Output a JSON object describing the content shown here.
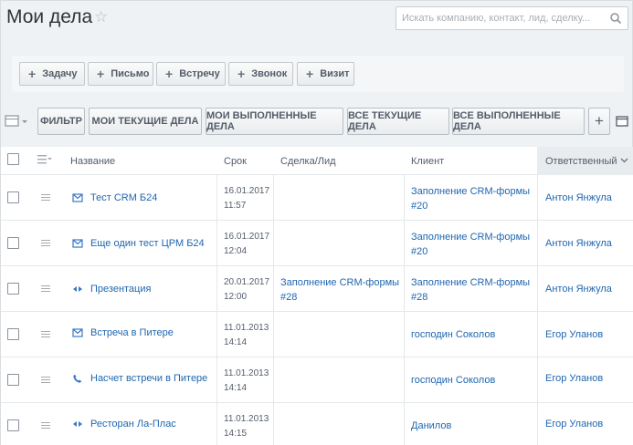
{
  "header": {
    "title": "Мои дела",
    "star_icon": "star-icon",
    "search_placeholder": "Искать компанию, контакт, лид, сделку...",
    "search_icon": "search-icon"
  },
  "actions": [
    {
      "label": "Задачу"
    },
    {
      "label": "Письмо"
    },
    {
      "label": "Встречу"
    },
    {
      "label": "Звонок"
    },
    {
      "label": "Визит"
    }
  ],
  "filters": [
    {
      "label": "Фильтр"
    },
    {
      "label": "Мои текущие дела"
    },
    {
      "label": "Мои выполненные дела"
    },
    {
      "label": "Все текущие дела"
    },
    {
      "label": "Все выполненные дела"
    }
  ],
  "filter_add_label": "+",
  "columns": {
    "name": "Название",
    "deadline": "Срок",
    "deal": "Сделка/Лид",
    "client": "Клиент",
    "responsible": "Ответственный"
  },
  "rows": [
    {
      "type_icon": "email-icon",
      "name": "Тест CRM Б24",
      "date": "16.01.2017",
      "time": "11:57",
      "deal_line1": "",
      "deal_line2": "",
      "client_line1": "Заполнение CRM-формы",
      "client_line2": "#20",
      "responsible": "Антон Янжула"
    },
    {
      "type_icon": "email-icon",
      "name": "Еще один тест ЦРМ Б24",
      "date": "16.01.2017",
      "time": "12:04",
      "deal_line1": "",
      "deal_line2": "",
      "client_line1": "Заполнение CRM-формы",
      "client_line2": "#20",
      "responsible": "Антон Янжула"
    },
    {
      "type_icon": "meeting-icon",
      "name": "Презентация",
      "date": "20.01.2017",
      "time": "12:00",
      "deal_line1": "Заполнение CRM-формы",
      "deal_line2": "#28",
      "client_line1": "Заполнение CRM-формы",
      "client_line2": "#28",
      "responsible": "Антон Янжула"
    },
    {
      "type_icon": "email-icon",
      "name": "Встреча в Питере",
      "date": "11.01.2013",
      "time": "14:14",
      "deal_line1": "",
      "deal_line2": "",
      "client_line1": "господин Соколов",
      "client_line2": "",
      "responsible": "Егор Уланов"
    },
    {
      "type_icon": "call-icon",
      "name": "Насчет встречи в Питере",
      "date": "11.01.2013",
      "time": "14:14",
      "deal_line1": "",
      "deal_line2": "",
      "client_line1": "господин Соколов",
      "client_line2": "",
      "responsible": "Егор Уланов"
    },
    {
      "type_icon": "meeting-icon",
      "name": "Ресторан Ла-Плас",
      "date": "11.01.2013",
      "time": "14:15",
      "deal_line1": "",
      "deal_line2": "",
      "client_line1": "Данилов",
      "client_line2": "",
      "responsible": "Егор Уланов"
    }
  ]
}
